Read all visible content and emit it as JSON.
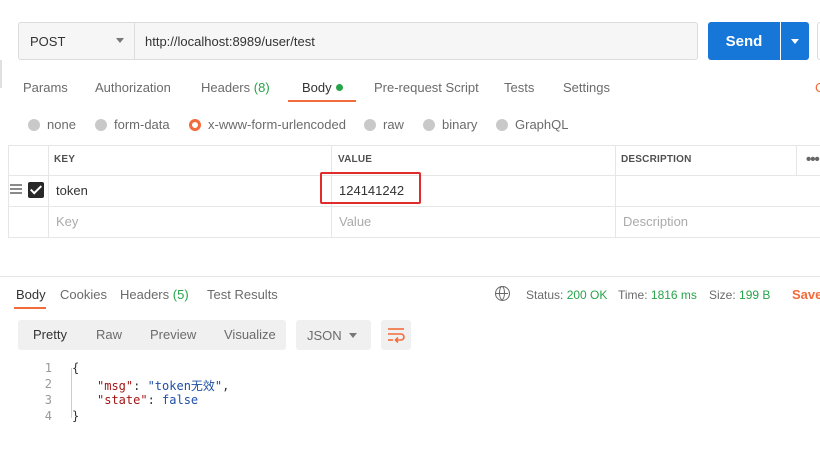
{
  "request": {
    "method": "POST",
    "url": "http://localhost:8989/user/test",
    "send_label": "Send"
  },
  "request_tabs": {
    "params": "Params",
    "authorization": "Authorization",
    "headers": "Headers",
    "headers_count": "(8)",
    "body": "Body",
    "prerequest": "Pre-request Script",
    "tests": "Tests",
    "settings": "Settings",
    "edge_cut": "C"
  },
  "body_types": {
    "none": "none",
    "form_data": "form-data",
    "urlencoded": "x-www-form-urlencoded",
    "raw": "raw",
    "binary": "binary",
    "graphql": "GraphQL",
    "selected": "x-www-form-urlencoded"
  },
  "kv_table": {
    "headers": {
      "key": "KEY",
      "value": "VALUE",
      "description": "DESCRIPTION"
    },
    "rows": [
      {
        "key": "token",
        "value": "124141242",
        "description": "",
        "checked": true
      }
    ],
    "placeholder": {
      "key": "Key",
      "value": "Value",
      "description": "Description"
    },
    "more": "•••"
  },
  "response_tabs": {
    "body": "Body",
    "cookies": "Cookies",
    "headers": "Headers",
    "headers_count": "(5)",
    "test_results": "Test Results"
  },
  "response_meta": {
    "status_label": "Status:",
    "status_value": "200 OK",
    "time_label": "Time:",
    "time_value": "1816 ms",
    "size_label": "Size:",
    "size_value": "199 B",
    "save_label": "Save"
  },
  "view_modes": {
    "pretty": "Pretty",
    "raw": "Raw",
    "preview": "Preview",
    "visualize": "Visualize",
    "format": "JSON"
  },
  "response_body": {
    "line_numbers": [
      "1",
      "2",
      "3",
      "4"
    ],
    "open_brace": "{",
    "close_brace": "}",
    "line2_key": "\"msg\"",
    "line2_value": "\"token无效\"",
    "line3_key": "\"state\"",
    "line3_value": "false"
  },
  "colors": {
    "accent": "#f26b3a",
    "send": "#1677d9",
    "success": "#26a44a",
    "highlight_box": "#e22b2b"
  },
  "icons": [
    "chevron-down-icon",
    "drag-handle-icon",
    "checkbox-checked-icon",
    "globe-icon",
    "wrap-lines-icon"
  ]
}
